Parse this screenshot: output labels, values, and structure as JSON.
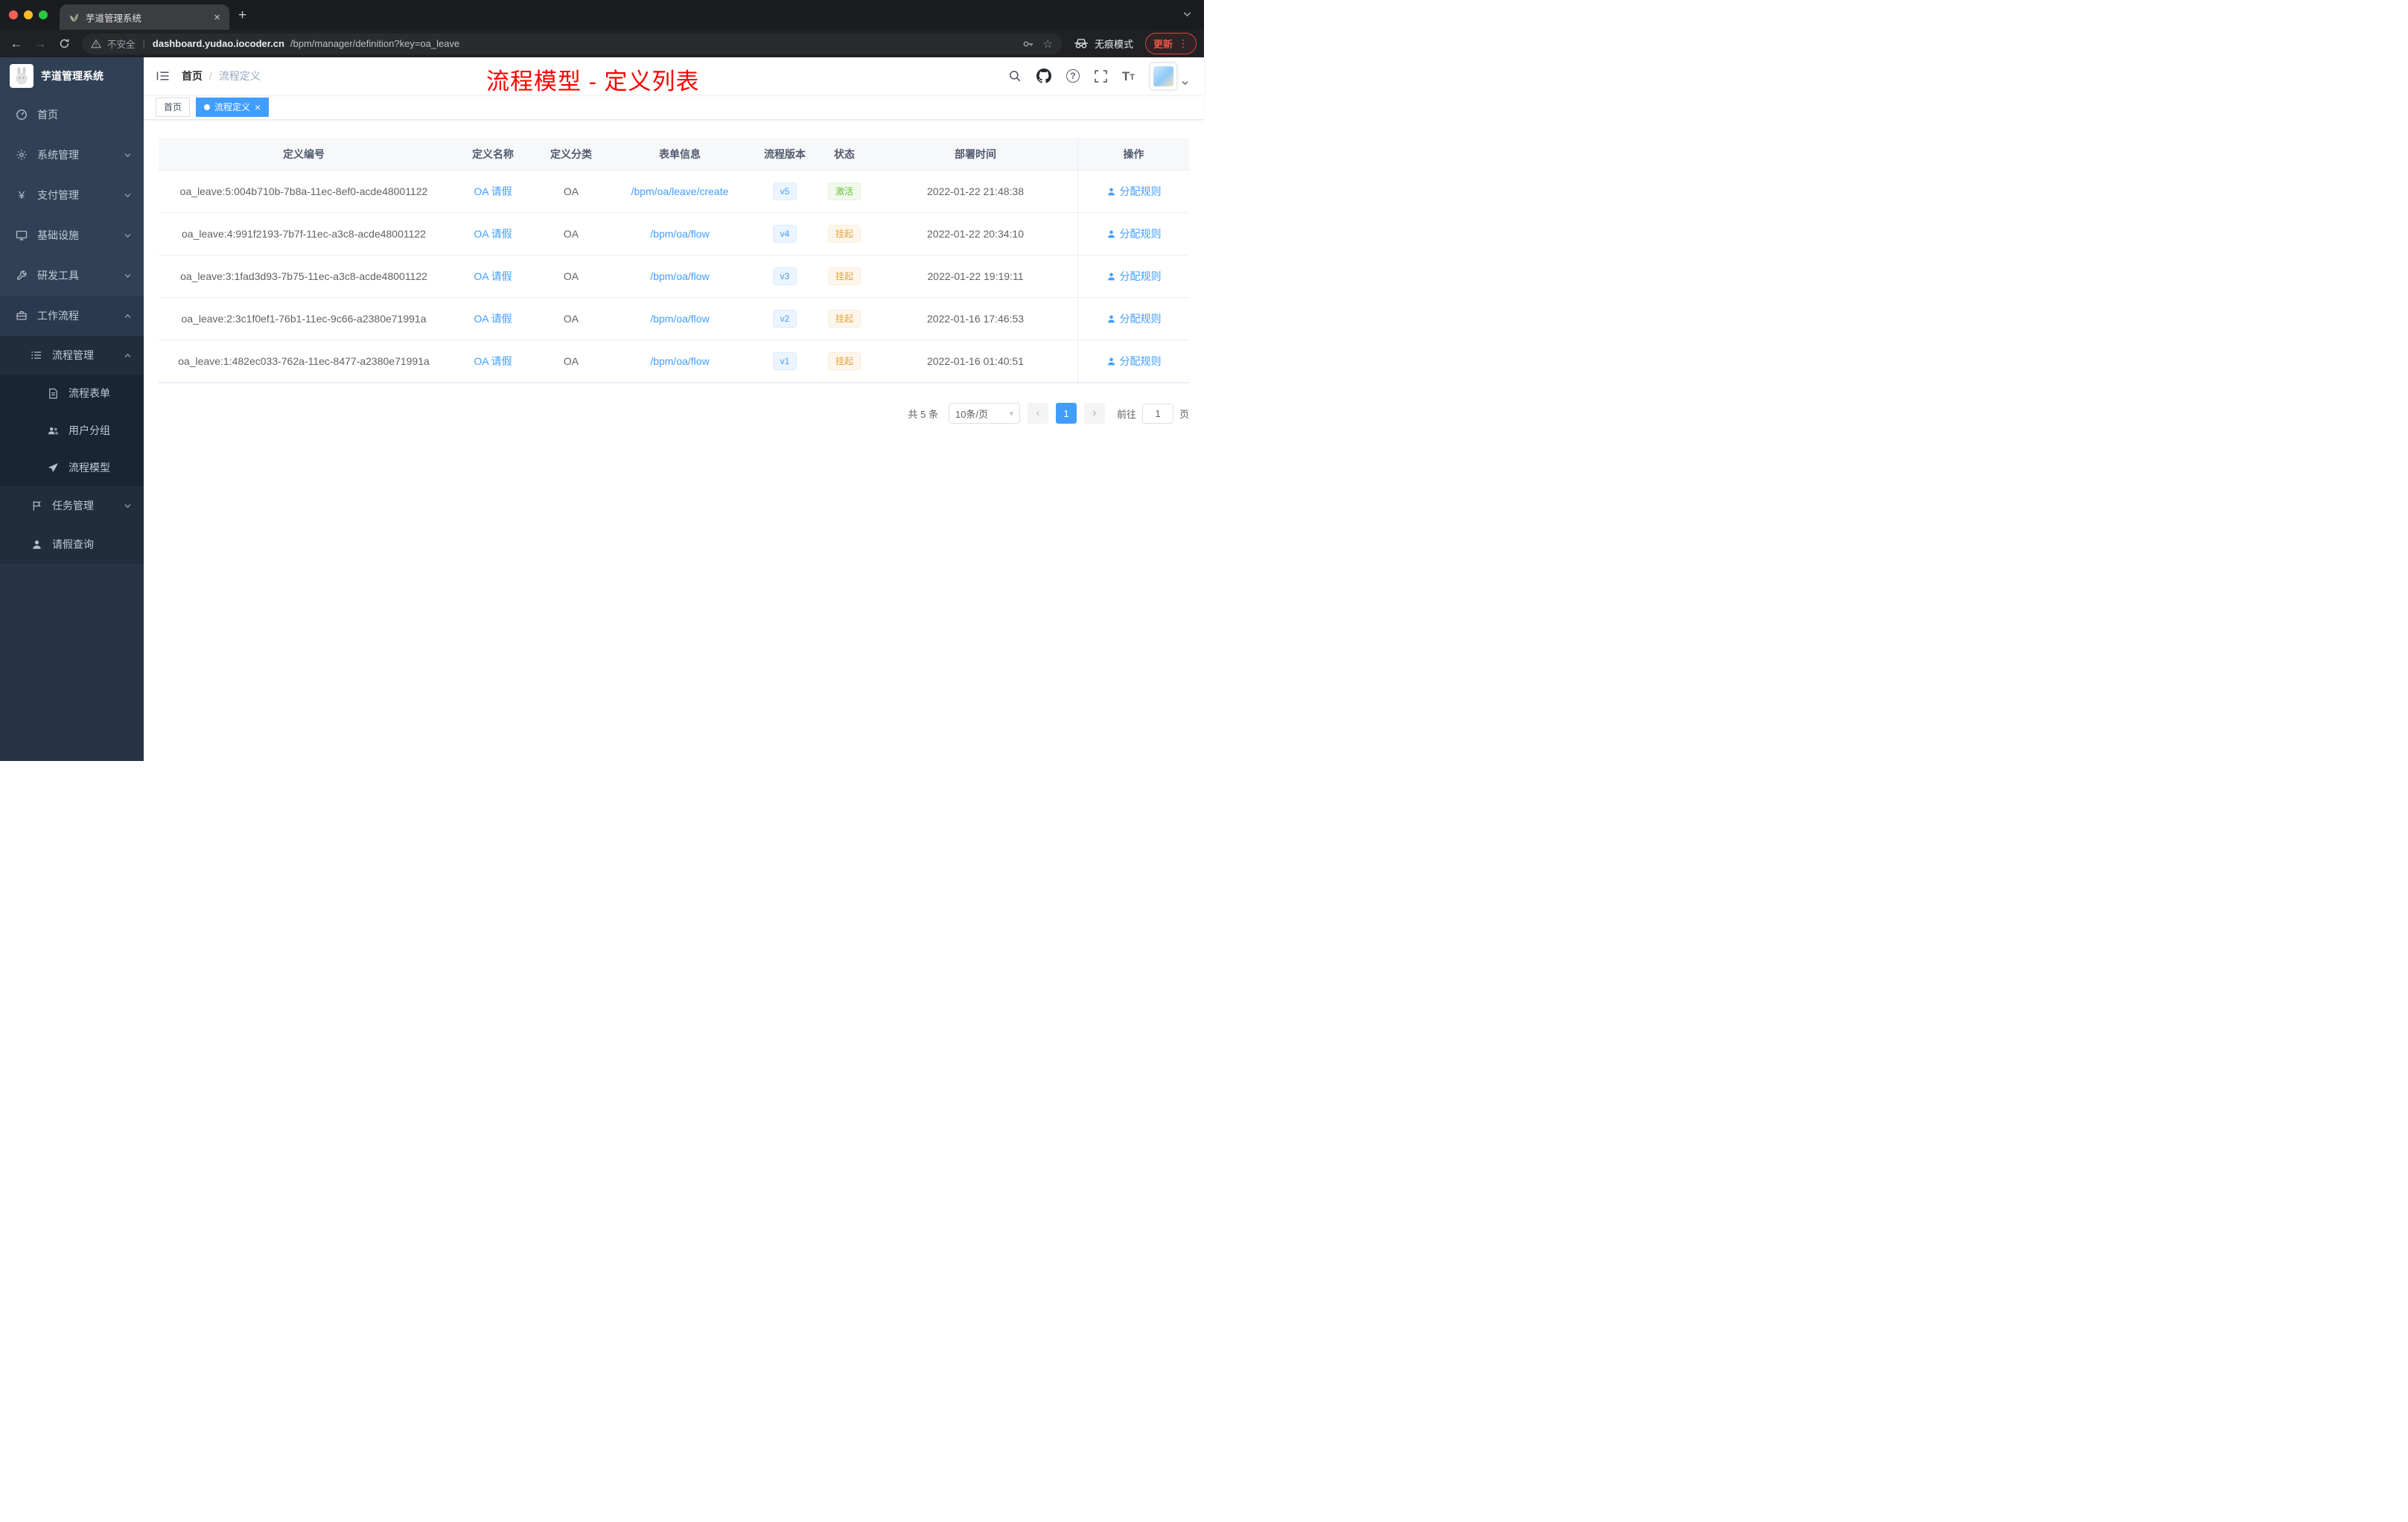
{
  "browser": {
    "tab_title": "芋道管理系统",
    "security_label": "不安全",
    "url_host": "dashboard.yudao.iocoder.cn",
    "url_path": "/bpm/manager/definition?key=oa_leave",
    "incognito_label": "无痕模式",
    "update_label": "更新"
  },
  "sidebar": {
    "logo_title": "芋道管理系统",
    "items": [
      "首页",
      "系统管理",
      "支付管理",
      "基础设施",
      "研发工具",
      "工作流程",
      "流程管理",
      "流程表单",
      "用户分组",
      "流程模型",
      "任务管理",
      "请假查询"
    ]
  },
  "header": {
    "breadcrumb": [
      "首页",
      "流程定义"
    ],
    "annotation": "流程模型 - 定义列表"
  },
  "tags": {
    "home": "首页",
    "active": "流程定义"
  },
  "table": {
    "headers": [
      "定义编号",
      "定义名称",
      "定义分类",
      "表单信息",
      "流程版本",
      "状态",
      "部署时间",
      "操作"
    ],
    "rows": [
      {
        "id": "oa_leave:5:004b710b-7b8a-11ec-8ef0-acde48001122",
        "name": "OA 请假",
        "category": "OA",
        "form": "/bpm/oa/leave/create",
        "version": "v5",
        "status": "激活",
        "status_type": "success",
        "time": "2022-01-22 21:48:38",
        "action": "分配规则"
      },
      {
        "id": "oa_leave:4:991f2193-7b7f-11ec-a3c8-acde48001122",
        "name": "OA 请假",
        "category": "OA",
        "form": "/bpm/oa/flow",
        "version": "v4",
        "status": "挂起",
        "status_type": "warning",
        "time": "2022-01-22 20:34:10",
        "action": "分配规则"
      },
      {
        "id": "oa_leave:3:1fad3d93-7b75-11ec-a3c8-acde48001122",
        "name": "OA 请假",
        "category": "OA",
        "form": "/bpm/oa/flow",
        "version": "v3",
        "status": "挂起",
        "status_type": "warning",
        "time": "2022-01-22 19:19:11",
        "action": "分配规则"
      },
      {
        "id": "oa_leave:2:3c1f0ef1-76b1-11ec-9c66-a2380e71991a",
        "name": "OA 请假",
        "category": "OA",
        "form": "/bpm/oa/flow",
        "version": "v2",
        "status": "挂起",
        "status_type": "warning",
        "time": "2022-01-16 17:46:53",
        "action": "分配规则"
      },
      {
        "id": "oa_leave:1:482ec033-762a-11ec-8477-a2380e71991a",
        "name": "OA 请假",
        "category": "OA",
        "form": "/bpm/oa/flow",
        "version": "v1",
        "status": "挂起",
        "status_type": "warning",
        "time": "2022-01-16 01:40:51",
        "action": "分配规则"
      }
    ]
  },
  "pagination": {
    "total": "共 5 条",
    "page_size": "10条/页",
    "current_page": "1",
    "goto_label": "前往",
    "goto_value": "1",
    "page_unit": "页"
  },
  "icons": {
    "close": "×",
    "new_tab": "+",
    "back": "←",
    "forward": "→",
    "divider": "|",
    "star": "☆",
    "more_vertical": "⋮",
    "breadcrumb_sep": "/",
    "caret_down": "▾",
    "prev": "‹",
    "next": "›",
    "yen": "¥",
    "question": "?",
    "font_t": "T"
  },
  "colors": {
    "accent": "#409eff",
    "success": "#67c23a",
    "warning": "#e6a23c",
    "annotation": "#fe0000",
    "sidebar_bg": "#304156",
    "submenu_bg": "#1f2d3d"
  }
}
